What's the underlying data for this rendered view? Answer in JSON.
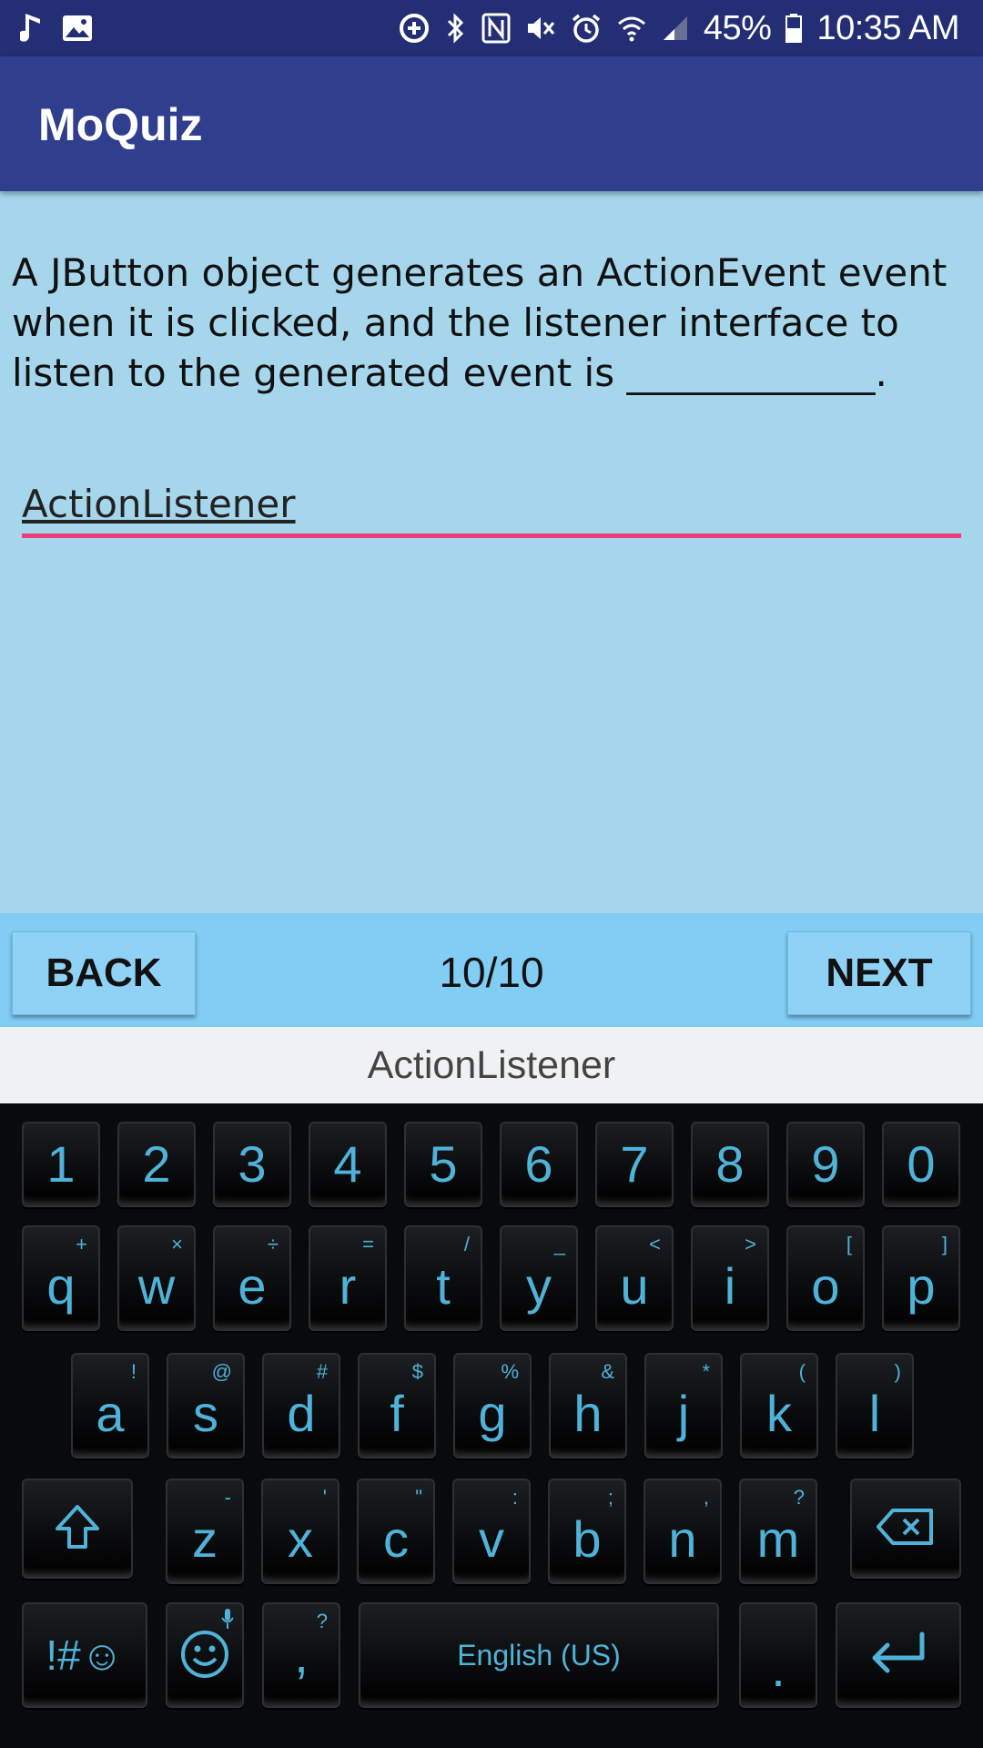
{
  "status_bar": {
    "battery": "45%",
    "time": "10:35 AM",
    "icons": [
      "music-note-icon",
      "image-icon",
      "data-saver-icon",
      "bluetooth-icon",
      "nfc-icon",
      "mute-icon",
      "alarm-icon",
      "wifi-icon",
      "signal-icon",
      "battery-icon"
    ]
  },
  "app": {
    "title": "MoQuiz"
  },
  "question": {
    "text": "A JButton object generates an ActionEvent event when it is clicked, and the listener interface to listen to the generated event is _____________."
  },
  "answer": {
    "value": "ActionListener"
  },
  "nav": {
    "back_label": "BACK",
    "counter": "10/10",
    "next_label": "NEXT"
  },
  "suggestion": {
    "text": "ActionListener"
  },
  "keyboard": {
    "number_row": [
      "1",
      "2",
      "3",
      "4",
      "5",
      "6",
      "7",
      "8",
      "9",
      "0"
    ],
    "row1": [
      {
        "key": "q",
        "sec": "+"
      },
      {
        "key": "w",
        "sec": "×"
      },
      {
        "key": "e",
        "sec": "÷"
      },
      {
        "key": "r",
        "sec": "="
      },
      {
        "key": "t",
        "sec": "/"
      },
      {
        "key": "y",
        "sec": "_"
      },
      {
        "key": "u",
        "sec": "<"
      },
      {
        "key": "i",
        "sec": ">"
      },
      {
        "key": "o",
        "sec": "["
      },
      {
        "key": "p",
        "sec": "]"
      }
    ],
    "row2": [
      {
        "key": "a",
        "sec": "!"
      },
      {
        "key": "s",
        "sec": "@"
      },
      {
        "key": "d",
        "sec": "#"
      },
      {
        "key": "f",
        "sec": "$"
      },
      {
        "key": "g",
        "sec": "%"
      },
      {
        "key": "h",
        "sec": "&"
      },
      {
        "key": "j",
        "sec": "*"
      },
      {
        "key": "k",
        "sec": "("
      },
      {
        "key": "l",
        "sec": ")"
      }
    ],
    "row3": [
      {
        "key": "z",
        "sec": "-"
      },
      {
        "key": "x",
        "sec": "'"
      },
      {
        "key": "c",
        "sec": "\""
      },
      {
        "key": "v",
        "sec": ":"
      },
      {
        "key": "b",
        "sec": ";"
      },
      {
        "key": "n",
        "sec": ","
      },
      {
        "key": "m",
        "sec": "?"
      }
    ],
    "symbols_label": "!#☺",
    "comma": {
      "key": ",",
      "sec": "?"
    },
    "space_label": "English (US)",
    "period": "."
  }
}
